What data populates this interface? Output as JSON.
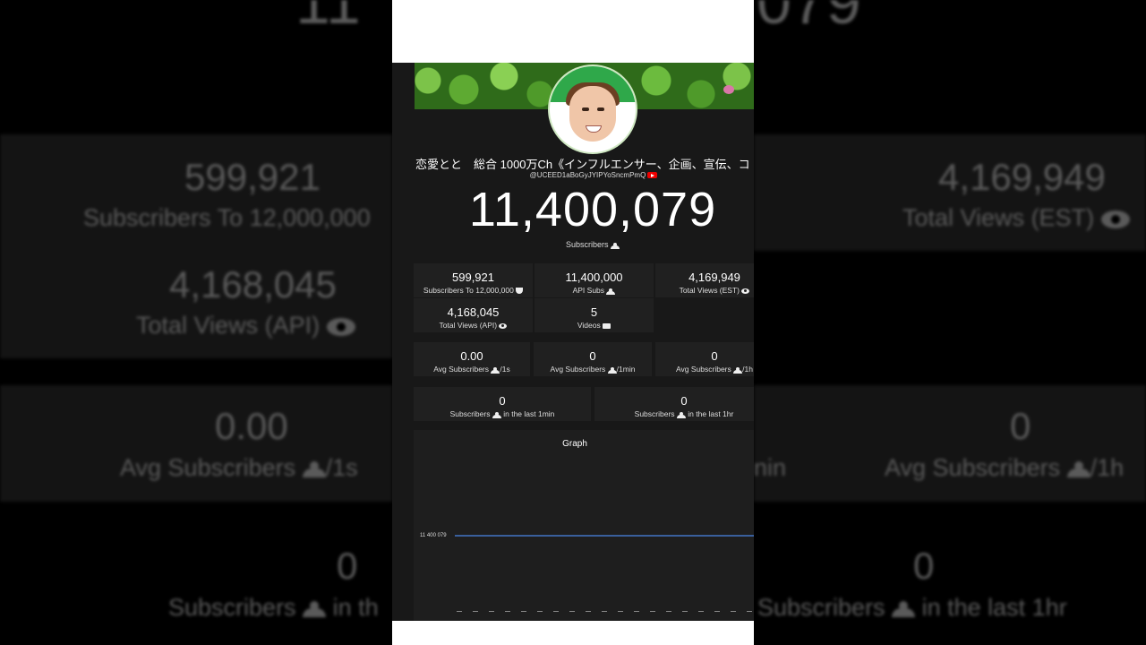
{
  "background": {
    "top_left_fragment": "11",
    "top_right_fragment": "079",
    "left": [
      {
        "value": "599,921",
        "label": "Subscribers To 12,000,000"
      },
      {
        "value": "4,168,045",
        "label": "Total Views (API)"
      },
      {
        "value": "0.00",
        "label": "Avg Subscribers",
        "suffix": "/1s"
      },
      {
        "value": "0",
        "label": "Subscribers",
        "suffix": "in th"
      }
    ],
    "right": [
      {
        "value": "4,169,949",
        "label": "Total Views (EST)"
      },
      {
        "value": "0",
        "label": "Avg Subscribers",
        "suffix": "/1h"
      },
      {
        "value": "0",
        "label": "Subscribers",
        "suffix": "in the last 1hr"
      }
    ],
    "mid_fragment_1": "nin",
    "mid_fragment_2": "Subscribers"
  },
  "channel": {
    "name": "恋愛とと　総合 1000万Ch《インフルエンサー、企画、宣伝、コ",
    "id": "@UCEED1aBoGyJYIPYoSncmPmQ"
  },
  "subscribers": {
    "count": "11,400,079",
    "label": "Subscribers"
  },
  "stats": [
    {
      "value": "599,921",
      "label": "Subscribers To 12,000,000",
      "icon": "trophy-icon"
    },
    {
      "value": "11,400,000",
      "label": "API Subs",
      "icon": "people-icon"
    },
    {
      "value": "4,169,949",
      "label": "Total Views (EST)",
      "icon": "eye-icon"
    },
    {
      "value": "4,168,045",
      "label": "Total Views (API)",
      "icon": "eye-icon"
    },
    {
      "value": "5",
      "label": "Videos",
      "icon": "video-icon"
    }
  ],
  "averages": [
    {
      "value": "0.00",
      "label": "Avg Subscribers",
      "suffix": "/1s"
    },
    {
      "value": "0",
      "label": "Avg Subscribers",
      "suffix": "/1min"
    },
    {
      "value": "0",
      "label": "Avg Subscribers",
      "suffix": "/1h"
    }
  ],
  "recent": [
    {
      "value": "0",
      "label": "Subscribers",
      "suffix": "in the last 1min"
    },
    {
      "value": "0",
      "label": "Subscribers",
      "suffix": "in the last 1hr"
    }
  ],
  "graph": {
    "title": "Graph",
    "line_color": "#4a86e8"
  },
  "chart_data": {
    "type": "line",
    "title": "Graph",
    "ytick_labels": [
      "11 400 079"
    ],
    "series": [
      {
        "values": [
          11400079,
          11400079
        ]
      }
    ]
  }
}
